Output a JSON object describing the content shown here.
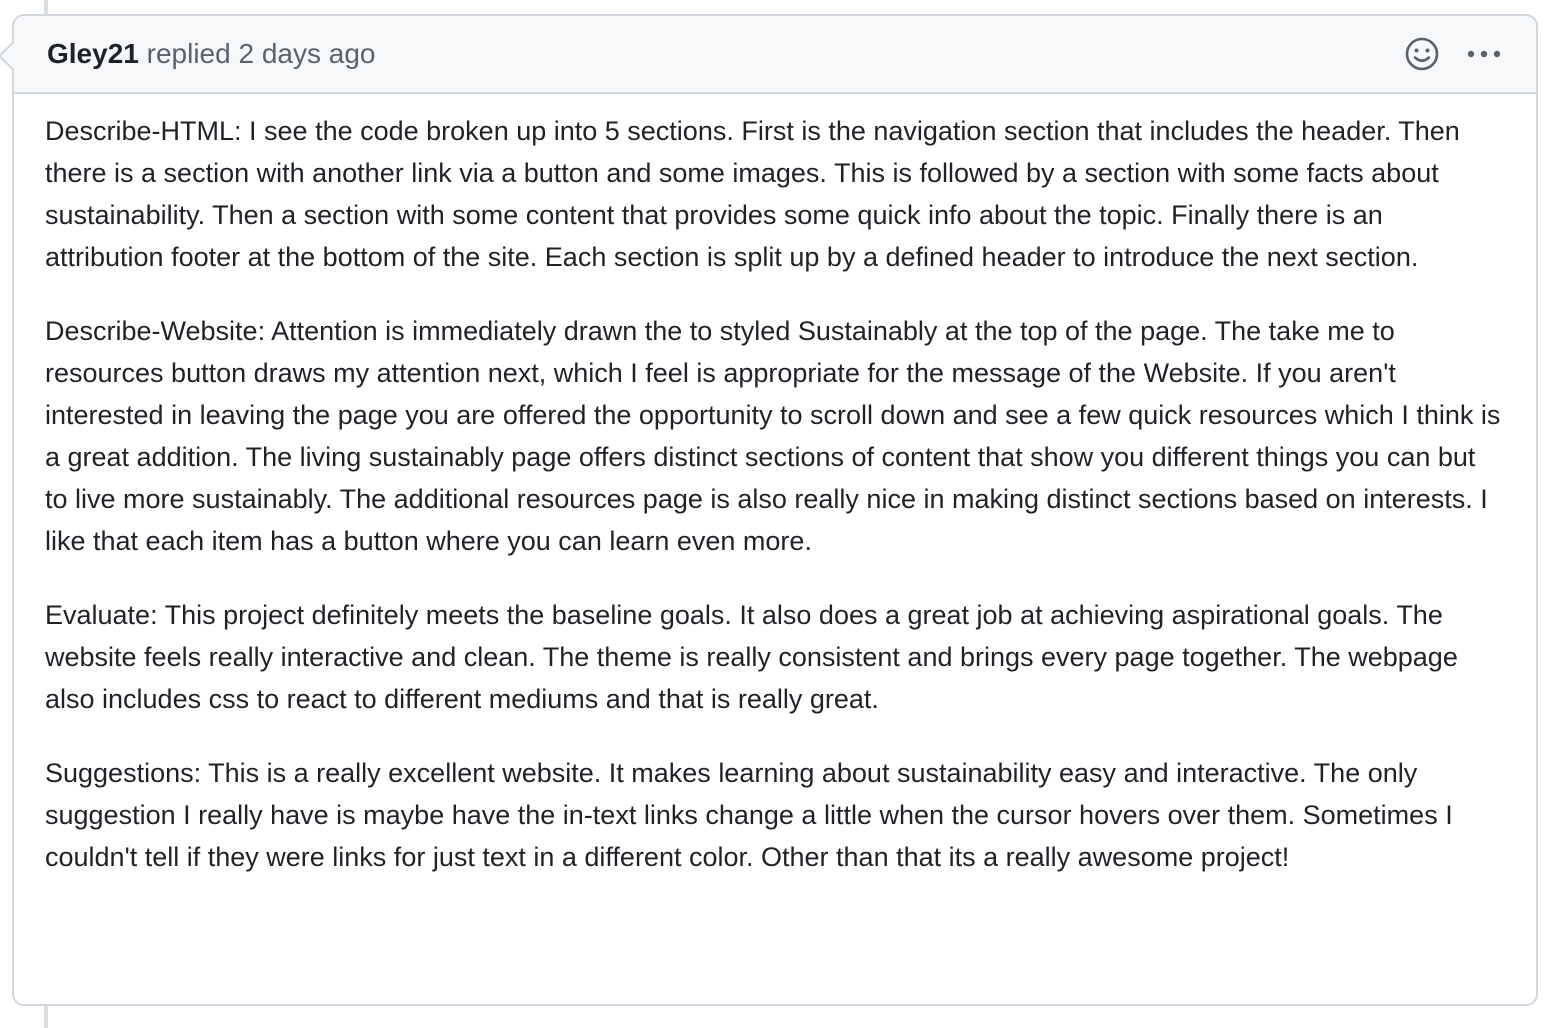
{
  "comment": {
    "author": "Gley21",
    "action_text": "replied 2 days ago",
    "icons": {
      "reaction": "smiley-icon",
      "more": "kebab-horizontal-icon"
    },
    "paragraphs": [
      "Describe-HTML: I see the code broken up into 5 sections. First is the navigation section that includes the header. Then there is a section with another link via a button and some images. This is followed by a section with some facts about sustainability. Then a section with some content that provides some quick info about the topic. Finally there is an attribution footer at the bottom of the site. Each section is split up by a defined header to introduce the next section.",
      "Describe-Website: Attention is immediately drawn the to styled Sustainably at the top of the page. The take me to resources button draws my attention next, which I feel is appropriate for the message of the Website. If you aren't interested in leaving the page you are offered the opportunity to scroll down and see a few quick resources which I think is a great addition. The living sustainably page offers distinct sections of content that show you different things you can but to live more sustainably. The additional resources page is also really nice in making distinct sections based on interests. I like that each item has a button where you can learn even more.",
      "Evaluate: This project definitely meets the baseline goals. It also does a great job at achieving aspirational goals. The website feels really interactive and clean. The theme is really consistent and brings every page together. The webpage also includes css to react to different mediums and that is really great.",
      "Suggestions: This is a really excellent website. It makes learning about sustainability easy and interactive. The only suggestion I really have is maybe have the in-text links change a little when the cursor hovers over them. Sometimes I couldn't tell if they were links for just text in a different color. Other than that its a really awesome project!"
    ]
  },
  "colors": {
    "border": "#d0d7de",
    "header_bg": "#f6f8fa",
    "text": "#1f2328",
    "muted": "#59636e"
  }
}
